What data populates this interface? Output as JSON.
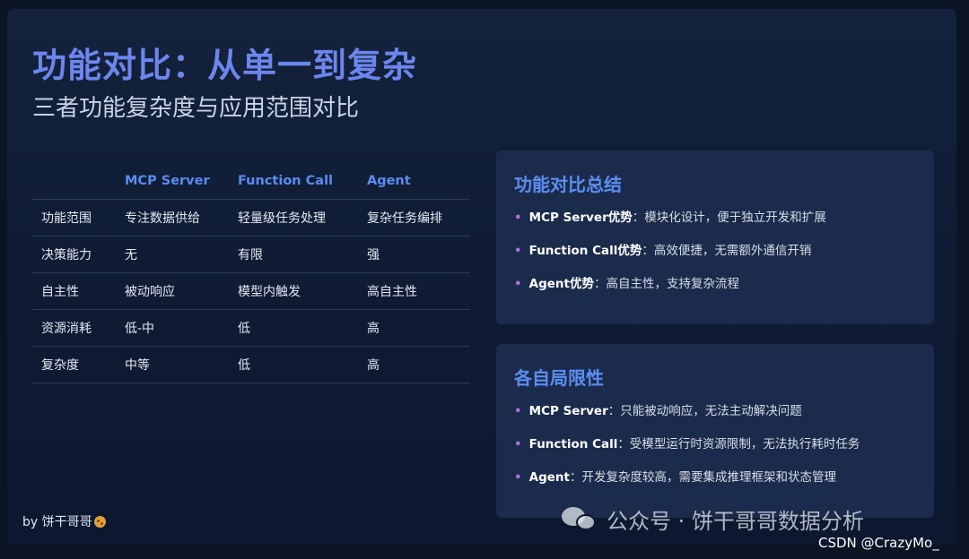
{
  "title": "功能对比：从单一到复杂",
  "subtitle": "三者功能复杂度与应用范围对比",
  "table": {
    "headers": [
      "",
      "MCP Server",
      "Function Call",
      "Agent"
    ],
    "rows": [
      [
        "功能范围",
        "专注数据供给",
        "轻量级任务处理",
        "复杂任务编排"
      ],
      [
        "决策能力",
        "无",
        "有限",
        "强"
      ],
      [
        "自主性",
        "被动响应",
        "模型内触发",
        "高自主性"
      ],
      [
        "资源消耗",
        "低-中",
        "低",
        "高"
      ],
      [
        "复杂度",
        "中等",
        "低",
        "高"
      ]
    ]
  },
  "summary": {
    "title": "功能对比总结",
    "items": [
      {
        "term": "MCP Server优势",
        "sep": "：",
        "desc": "模块化设计，便于独立开发和扩展"
      },
      {
        "term": "Function Call优势",
        "sep": "：",
        "desc": "高效便捷，无需额外通信开销"
      },
      {
        "term": "Agent优势",
        "sep": "：",
        "desc": "高自主性，支持复杂流程"
      }
    ]
  },
  "limits": {
    "title": "各自局限性",
    "items": [
      {
        "term": "MCP Server",
        "sep": "：",
        "desc": "只能被动响应，无法主动解决问题"
      },
      {
        "term": "Function Call",
        "sep": "：",
        "desc": "受模型运行时资源限制，无法执行耗时任务"
      },
      {
        "term": "Agent",
        "sep": "：",
        "desc": "开发复杂度较高，需要集成推理框架和状态管理"
      }
    ]
  },
  "byline": "by 饼干哥哥",
  "watermark": "公众号 · 饼干哥哥数据分析",
  "csdn": "CSDN @CrazyMo_",
  "colors": {
    "title": "#6d86ee",
    "accent": "#5a8cf0",
    "bullet": "#b06ad8",
    "card": "#1b2b4b"
  }
}
